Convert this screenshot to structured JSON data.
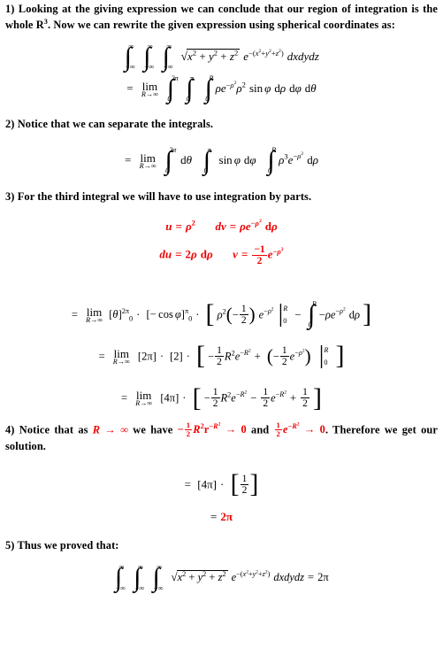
{
  "document": {
    "type": "math-proof",
    "title_visible": false,
    "text_color": "#000000",
    "accent_color": "#ee0000",
    "background": "#ffffff"
  },
  "steps": [
    {
      "number": "1)",
      "text": "Looking at the giving expression we can conclude that our region of integration is the whole R3. Now we can rewrite the given expression using spherical coordinates as:",
      "text_parts": {
        "before_symbol": "Looking at the giving expression we can conclude that our region of integration is the whole",
        "symbol": "R",
        "symbol_exponent": "3",
        "after_symbol": ". Now we can rewrite the given expression using spherical coordinates as:"
      }
    },
    {
      "number": "2)",
      "text": "Notice that we can separate the integrals."
    },
    {
      "number": "3)",
      "text": "For the third integral we will have to use integration by parts."
    },
    {
      "number": "4)",
      "text": "Notice that as R → ∞ we have −½R²r^(−R²) → 0 and ½e^(−R²) → 0. Therefore we get our solution.",
      "segments": [
        {
          "color": "#000000",
          "text": "Notice that as "
        },
        {
          "color": "#ee0000",
          "text": "R → ∞"
        },
        {
          "color": "#000000",
          "text": " we have "
        },
        {
          "color": "#ee0000",
          "text": "−(1/2)R²r^{−R²} → 0"
        },
        {
          "color": "#000000",
          "text": " and "
        },
        {
          "color": "#ee0000",
          "text": "(1/2)e^{−R²} → 0"
        },
        {
          "color": "#000000",
          "text": ". Therefore we get our solution."
        }
      ]
    },
    {
      "number": "5)",
      "text": "Thus we proved that:"
    }
  ],
  "equations": {
    "original_integral": {
      "label": "triple integral in cartesian coordinates",
      "outer": {
        "lower": "−∞",
        "upper": "∞"
      },
      "middle": {
        "lower": "−∞",
        "upper": "∞"
      },
      "inner": {
        "lower": "−∞",
        "upper": "∞"
      },
      "integrand_root": "x² + y² + z²",
      "integrand_exp": "−(x²+y²+z²)",
      "differentials": "dxdydz",
      "color": "#000000"
    },
    "spherical_integral": {
      "label": "rewritten in spherical coordinates",
      "limit_var": "R",
      "limit_to": "∞",
      "theta": {
        "lower": "0",
        "upper": "2π"
      },
      "phi": {
        "lower": "0",
        "upper": "π"
      },
      "rho": {
        "lower": "0",
        "upper": "R"
      },
      "integrand": "ρe^{−ρ²}ρ² sin φ",
      "differentials": "dρ dφ dθ",
      "color": "#000000"
    },
    "separated_integral": {
      "label": "separated product of three integrals",
      "limit_var": "R",
      "limit_to": "∞",
      "theta": {
        "lower": "0",
        "upper": "2π",
        "integrand": "dθ"
      },
      "phi": {
        "lower": "0",
        "upper": "π",
        "integrand": "sin φ dφ"
      },
      "rho": {
        "lower": "0",
        "upper": "R",
        "integrand": "ρ³e^{−ρ²} dρ"
      },
      "color": "#000000"
    },
    "parts_uv": {
      "label": "integration by parts substitution line 1",
      "u": "u = ρ²",
      "dv": "dv = ρe^{−ρ²} dρ",
      "color": "#ee0000"
    },
    "parts_dudv": {
      "label": "integration by parts substitution line 2",
      "du": "du = 2ρ dρ",
      "v_numerator": "−1",
      "v_denominator": "2",
      "v_rest": "e^{−ρ²}",
      "color": "#ee0000"
    },
    "expanded": {
      "label": "evaluated bracket expression with remaining integral",
      "limit_var": "R",
      "limit_to": "∞",
      "theta_bracket": "[θ]",
      "theta_lower": "0",
      "theta_upper": "2π",
      "phi_bracket": "[− cos φ]",
      "phi_lower": "0",
      "phi_upper": "π",
      "rho_term": "ρ²(−1/2)e^{−ρ²}",
      "eval_lower": "0",
      "eval_upper": "R",
      "remaining_integral": "− ∫₀^R −ρe^{−ρ²} dρ",
      "color": "#000000"
    },
    "substituted": {
      "label": "after evaluating theta and phi brackets",
      "limit_var": "R",
      "limit_to": "∞",
      "theta_value": "[2π]",
      "phi_value": "[2]",
      "term1": "−(1/2)R²e^{−R²}",
      "term2": "(−(1/2)e^{−ρ²})",
      "eval_lower": "0",
      "eval_upper": "R",
      "color": "#000000"
    },
    "simplified": {
      "label": "combined constant times bracket",
      "limit_var": "R",
      "limit_to": "∞",
      "constant": "[4π]",
      "term1": "−(1/2)R²e^{−R²}",
      "term2": "−(1/2)e^{−R²}",
      "term3": "+1/2",
      "color": "#000000"
    },
    "final_product": {
      "label": "limit applied leaving product",
      "constant": "[4π]",
      "fraction_numerator": "1",
      "fraction_denominator": "2",
      "color": "#000000"
    },
    "final_value": {
      "label": "final numeric result",
      "value": "2π",
      "color": "#ee0000"
    },
    "conclusion_integral": {
      "label": "restated theorem with result",
      "outer": {
        "lower": "−∞",
        "upper": "∞"
      },
      "middle": {
        "lower": "−∞",
        "upper": "∞"
      },
      "inner": {
        "lower": "−∞",
        "upper": "∞"
      },
      "integrand_root": "x² + y² + z²",
      "integrand_exp": "−(x²+y²+z²)",
      "differentials": "dxdydz",
      "result": "2π",
      "color": "#000000"
    }
  },
  "symbols": {
    "infinity": "∞",
    "pi": "π",
    "rho": "ρ",
    "phi": "φ",
    "theta": "θ",
    "arrow": "→",
    "cdot": "·",
    "minus": "−",
    "integral": "∫",
    "equals": "=",
    "plus": "+",
    "lim": "lim",
    "sin": "sin",
    "cos": "cos",
    "d": "d",
    "R": "R",
    "r": "r",
    "e": "e",
    "u": "u",
    "v": "v",
    "x": "x",
    "y": "y",
    "z": "z"
  }
}
